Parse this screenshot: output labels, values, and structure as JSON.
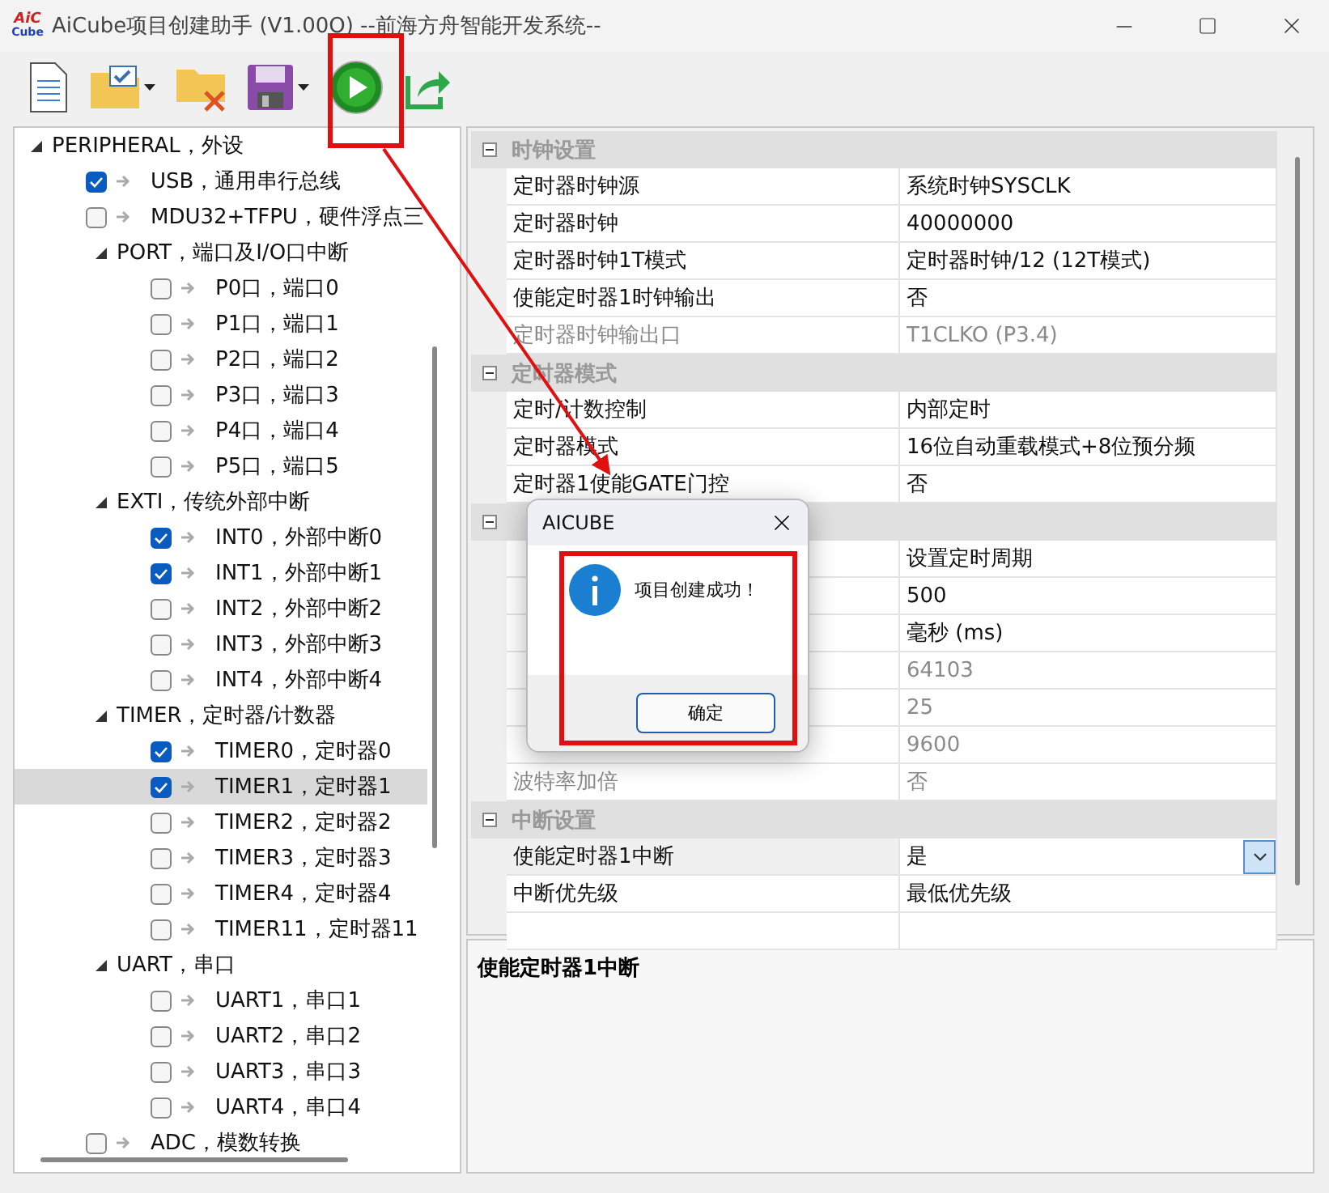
{
  "window": {
    "logo": [
      "AiC",
      "Cube"
    ],
    "title": "AiCube项目创建助手 (V1.00O) --前海方舟智能开发系统--"
  },
  "toolbar": [
    {
      "kind": "new"
    },
    {
      "kind": "open",
      "dropdown": true
    },
    {
      "kind": "close"
    },
    {
      "kind": "save",
      "dropdown": true
    },
    {
      "kind": "run"
    },
    {
      "kind": "export"
    }
  ],
  "tree": [
    {
      "kind": "group",
      "label": "PERIPHERAL，外设",
      "expanded": true,
      "selected": false,
      "children": [
        {
          "kind": "item",
          "label": "USB，通用串行总线",
          "checked": true,
          "selected": false
        },
        {
          "kind": "item",
          "label": "MDU32+TFPU，硬件浮点三",
          "checked": false,
          "selected": false
        },
        {
          "kind": "group",
          "label": "PORT，端口及I/O口中断",
          "expanded": true,
          "selected": false,
          "children": [
            {
              "kind": "item",
              "label": "P0口，端口0",
              "checked": false,
              "selected": false
            },
            {
              "kind": "item",
              "label": "P1口，端口1",
              "checked": false,
              "selected": false
            },
            {
              "kind": "item",
              "label": "P2口，端口2",
              "checked": false,
              "selected": false
            },
            {
              "kind": "item",
              "label": "P3口，端口3",
              "checked": false,
              "selected": false
            },
            {
              "kind": "item",
              "label": "P4口，端口4",
              "checked": false,
              "selected": false
            },
            {
              "kind": "item",
              "label": "P5口，端口5",
              "checked": false,
              "selected": false
            }
          ]
        },
        {
          "kind": "group",
          "label": "EXTI，传统外部中断",
          "expanded": true,
          "selected": false,
          "children": [
            {
              "kind": "item",
              "label": "INT0，外部中断0",
              "checked": true,
              "selected": false
            },
            {
              "kind": "item",
              "label": "INT1，外部中断1",
              "checked": true,
              "selected": false
            },
            {
              "kind": "item",
              "label": "INT2，外部中断2",
              "checked": false,
              "selected": false
            },
            {
              "kind": "item",
              "label": "INT3，外部中断3",
              "checked": false,
              "selected": false
            },
            {
              "kind": "item",
              "label": "INT4，外部中断4",
              "checked": false,
              "selected": false
            }
          ]
        },
        {
          "kind": "group",
          "label": "TIMER，定时器/计数器",
          "expanded": true,
          "selected": false,
          "children": [
            {
              "kind": "item",
              "label": "TIMER0，定时器0",
              "checked": true,
              "selected": false
            },
            {
              "kind": "item",
              "label": "TIMER1，定时器1",
              "checked": true,
              "selected": true
            },
            {
              "kind": "item",
              "label": "TIMER2，定时器2",
              "checked": false,
              "selected": false
            },
            {
              "kind": "item",
              "label": "TIMER3，定时器3",
              "checked": false,
              "selected": false
            },
            {
              "kind": "item",
              "label": "TIMER4，定时器4",
              "checked": false,
              "selected": false
            },
            {
              "kind": "item",
              "label": "TIMER11，定时器11",
              "checked": false,
              "selected": false
            }
          ]
        },
        {
          "kind": "group",
          "label": "UART，串口",
          "expanded": true,
          "selected": false,
          "children": [
            {
              "kind": "item",
              "label": "UART1，串口1",
              "checked": false,
              "selected": false
            },
            {
              "kind": "item",
              "label": "UART2，串口2",
              "checked": false,
              "selected": false
            },
            {
              "kind": "item",
              "label": "UART3，串口3",
              "checked": false,
              "selected": false
            },
            {
              "kind": "item",
              "label": "UART4，串口4",
              "checked": false,
              "selected": false
            }
          ]
        },
        {
          "kind": "item",
          "label": "ADC，模数转换",
          "checked": false,
          "selected": false
        }
      ]
    }
  ],
  "properties": [
    {
      "title": "时钟设置",
      "expanded": true,
      "rows": [
        {
          "label": "定时器时钟源",
          "value": "系统时钟SYSCLK",
          "disabled": false,
          "selected": false
        },
        {
          "label": "定时器时钟",
          "value": "40000000",
          "disabled": false,
          "selected": false
        },
        {
          "label": "定时器时钟1T模式",
          "value": "定时器时钟/12 (12T模式)",
          "disabled": false,
          "selected": false
        },
        {
          "label": "使能定时器1时钟输出",
          "value": "否",
          "disabled": false,
          "selected": false
        },
        {
          "label": "定时器时钟输出口",
          "value": "T1CLKO (P3.4)",
          "disabled": true,
          "selected": false
        }
      ]
    },
    {
      "title": "定时器模式",
      "expanded": true,
      "rows": [
        {
          "label": "定时/计数控制",
          "value": "内部定时",
          "disabled": false,
          "selected": false
        },
        {
          "label": "定时器模式",
          "value": "16位自动重载模式+8位预分频",
          "disabled": false,
          "selected": false
        },
        {
          "label": "定时器1使能GATE门控",
          "value": "否",
          "disabled": false,
          "selected": false
        }
      ]
    },
    {
      "expanded": true,
      "rows": [
        {
          "value": "设置定时周期",
          "disabled": false,
          "selected": false
        },
        {
          "value": "500",
          "disabled": false,
          "selected": false
        },
        {
          "value": "毫秒 (ms)",
          "disabled": false,
          "selected": false
        },
        {
          "value": "64103",
          "disabled": true,
          "selected": false
        },
        {
          "value": "25",
          "disabled": true,
          "selected": false
        },
        {
          "value": "9600",
          "disabled": true,
          "selected": false
        },
        {
          "label": "波特率加倍",
          "value": "否",
          "disabled": true,
          "selected": false
        }
      ]
    },
    {
      "title": "中断设置",
      "expanded": true,
      "rows": [
        {
          "label": "使能定时器1中断",
          "value": "是",
          "disabled": false,
          "selected": true
        },
        {
          "label": "中断优先级",
          "value": "最低优先级",
          "disabled": false,
          "selected": false
        }
      ]
    }
  ],
  "description": {
    "title": "使能定时器1中断"
  },
  "dialog": {
    "title": "AICUBE",
    "message": "项目创建成功！",
    "button": "确定"
  }
}
